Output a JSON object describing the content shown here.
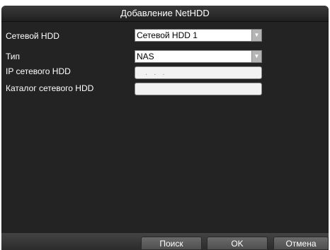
{
  "dialog": {
    "title": "Добавление NetHDD"
  },
  "form": {
    "net_hdd": {
      "label": "Сетевой HDD",
      "value": "Сетевой HDD 1",
      "arrow_icon": "chevron-down-icon"
    },
    "type": {
      "label": "Тип",
      "value": "NAS",
      "arrow_icon": "chevron-down-icon"
    },
    "ip": {
      "label": "IP сетевого HDD",
      "value": ".   .   .",
      "placeholder": ""
    },
    "directory": {
      "label": "Каталог сетевого HDD",
      "value": ""
    }
  },
  "footer": {
    "search_label": "Поиск",
    "ok_label": "OK",
    "cancel_label": "Отмена"
  },
  "colors": {
    "background": "#232323",
    "title_bar": "#2b2b2b",
    "field": "#ffffff",
    "button": "#5e5e5e",
    "text": "#ffffff"
  }
}
